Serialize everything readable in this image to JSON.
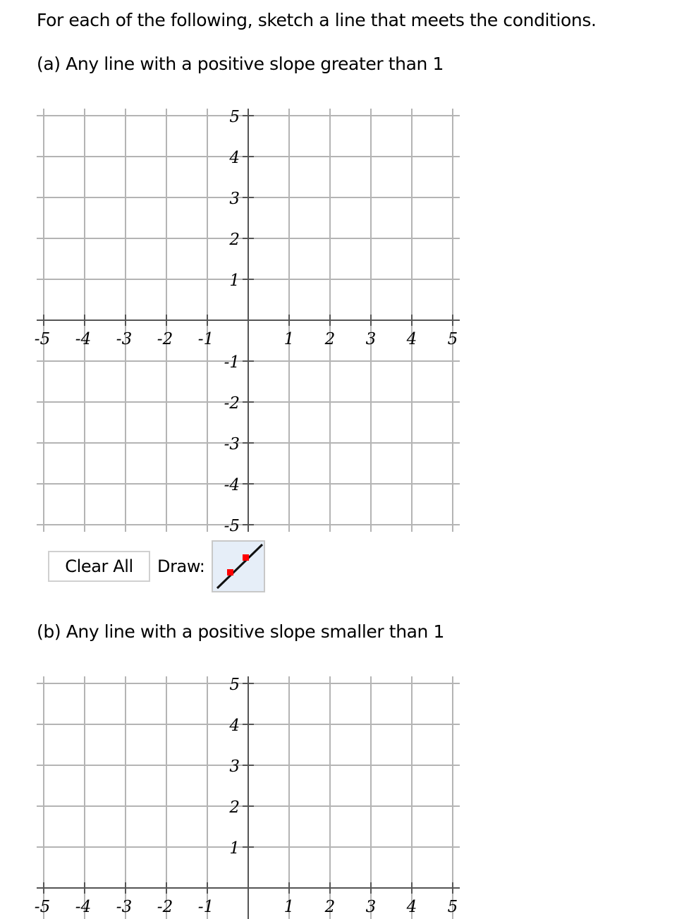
{
  "instructions": "For each of the following, sketch a line that meets the conditions.",
  "questions": [
    {
      "label": "(a) Any line with a positive slope greater than 1",
      "graph": {
        "xlim": [
          -5,
          5
        ],
        "ylim": [
          -5,
          5
        ],
        "x_ticks": [
          "-5",
          "-4",
          "-3",
          "-2",
          "-1",
          "1",
          "2",
          "3",
          "4",
          "5"
        ],
        "y_ticks": [
          "5",
          "4",
          "3",
          "2",
          "1",
          "-1",
          "-2",
          "-3",
          "-4",
          "-5"
        ],
        "grid": true
      },
      "controls": {
        "clear_label": "Clear All",
        "draw_label": "Draw:",
        "tool": "line-tool-icon",
        "tool_colors": {
          "background": "#e6eef8",
          "line": "#111111",
          "points": "#ff0000"
        }
      }
    },
    {
      "label": "(b) Any line with a positive slope smaller than 1",
      "graph": {
        "xlim": [
          -5,
          5
        ],
        "ylim": [
          -5,
          5
        ],
        "x_ticks": [
          "-5",
          "-4",
          "-3",
          "-2",
          "-1",
          "1",
          "2",
          "3",
          "4",
          "5"
        ],
        "y_ticks": [
          "5",
          "4",
          "3",
          "2",
          "1"
        ],
        "grid": true
      }
    }
  ]
}
